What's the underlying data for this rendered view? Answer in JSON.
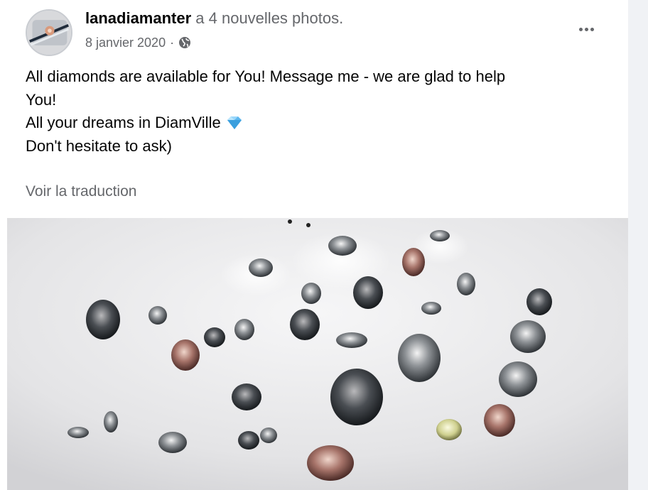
{
  "post": {
    "author": "lanadiamanter",
    "action_text": " a 4 nouvelles photos.",
    "date": "8 janvier 2020",
    "separator": "·",
    "audience_icon": "globe-icon",
    "more_icon": "more-options-icon",
    "text_lines": [
      "All diamonds are available for You! Message me  - we are glad to help",
      "You!",
      "All your dreams in DiamVille",
      "Don't hesitate to ask)"
    ],
    "inline_emoji": "diamond-icon",
    "translate_label": "Voir la traduction"
  },
  "photo": {
    "description_icon": "diamonds-photo",
    "background": "#e9e9eb"
  },
  "colors": {
    "text_primary": "#050505",
    "text_secondary": "#65676b",
    "sidebar_bg": "#f0f2f5"
  }
}
